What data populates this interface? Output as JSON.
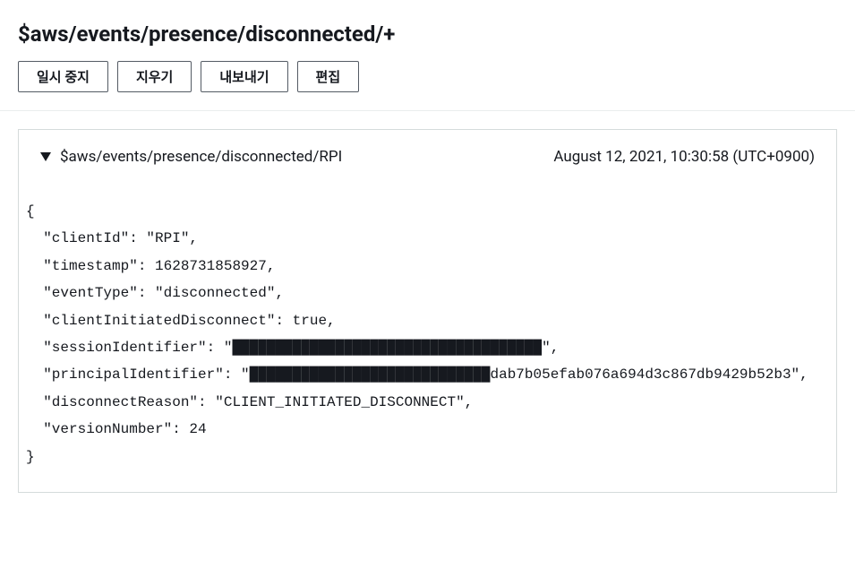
{
  "header": {
    "title": "$aws/events/presence/disconnected/+",
    "buttons": {
      "pause": "일시 중지",
      "clear": "지우기",
      "export": "내보내기",
      "edit": "편집"
    }
  },
  "message": {
    "topic": "$aws/events/presence/disconnected/RPI",
    "timestamp": "August 12, 2021, 10:30:58 (UTC+0900)",
    "payload": "{\n  \"clientId\": \"RPI\",\n  \"timestamp\": 1628731858927,\n  \"eventType\": \"disconnected\",\n  \"clientInitiatedDisconnect\": true,\n  \"sessionIdentifier\": \"████████████████████████████████████\",\n  \"principalIdentifier\": \"████████████████████████████dab7b05efab076a694d3c867db9429b52b3\",\n  \"disconnectReason\": \"CLIENT_INITIATED_DISCONNECT\",\n  \"versionNumber\": 24\n}"
  }
}
